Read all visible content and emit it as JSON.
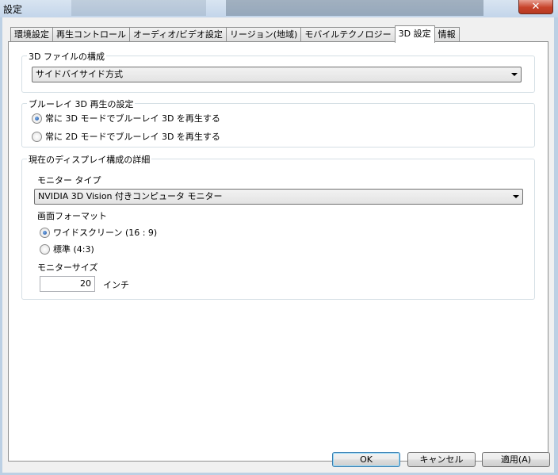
{
  "window": {
    "title": "設定",
    "close_glyph": "✕"
  },
  "tabs": [
    {
      "label": "環境設定"
    },
    {
      "label": "再生コントロール"
    },
    {
      "label": "オーディオ/ビデオ設定"
    },
    {
      "label": "リージョン(地域)"
    },
    {
      "label": "モバイルテクノロジー"
    },
    {
      "label": "3D 設定",
      "active": true
    },
    {
      "label": "情報"
    }
  ],
  "file_config": {
    "label": "3D ファイルの構成",
    "selected": "サイドバイサイド方式"
  },
  "bluray": {
    "label": "ブルーレイ 3D 再生の設定",
    "options": [
      {
        "label": "常に 3D モードでブルーレイ 3D を再生する",
        "checked": true
      },
      {
        "label": "常に 2D モードでブルーレイ 3D を再生する",
        "checked": false
      }
    ]
  },
  "display": {
    "label": "現在のディスプレイ構成の詳細",
    "monitor_type_label": "モニター タイプ",
    "monitor_type_selected": "NVIDIA 3D Vision 付きコンピュータ モニター",
    "format_label": "画面フォーマット",
    "format_options": [
      {
        "label": "ワイドスクリーン (16 : 9)",
        "checked": true
      },
      {
        "label": "標準 (4:3)",
        "checked": false
      }
    ],
    "size_label": "モニターサイズ",
    "size_value": "20",
    "size_unit": "インチ"
  },
  "buttons": {
    "ok": "OK",
    "cancel": "キャンセル",
    "apply": "適用(A)"
  }
}
